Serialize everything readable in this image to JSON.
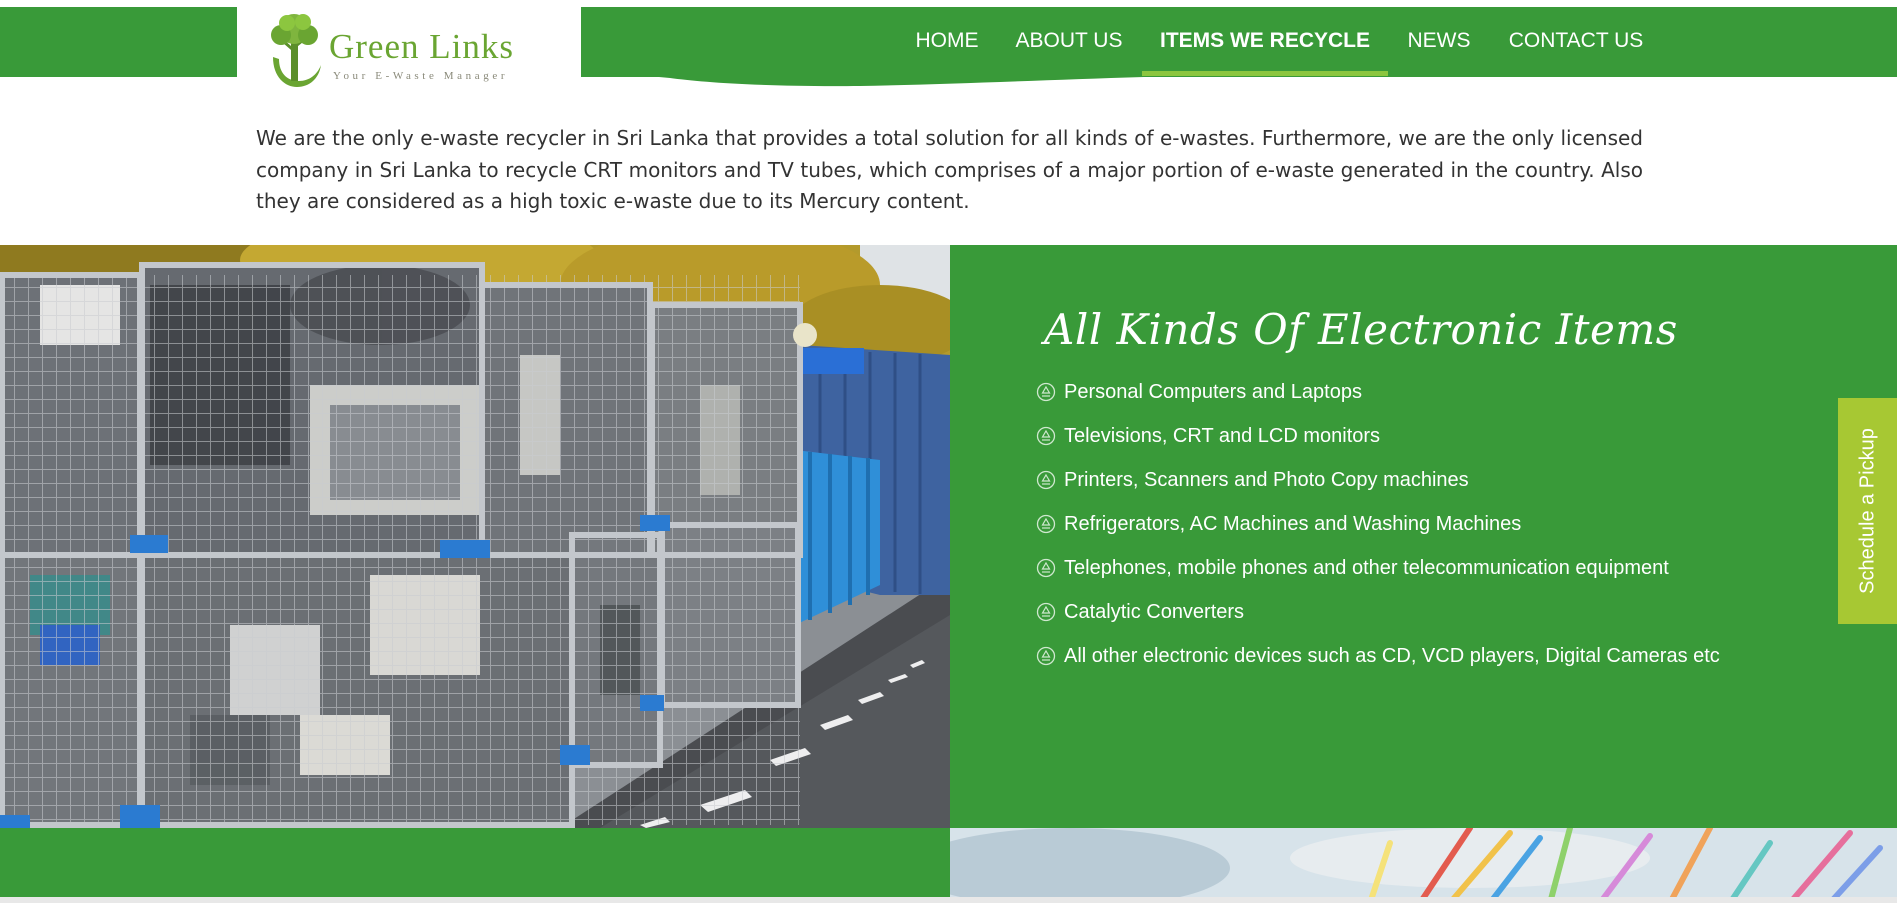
{
  "brand": {
    "name": "Green Links",
    "tagline": "Your E-Waste Manager"
  },
  "nav": {
    "items": [
      {
        "label": "HOME",
        "active": false
      },
      {
        "label": "ABOUT US",
        "active": false
      },
      {
        "label": "ITEMS WE RECYCLE",
        "active": true
      },
      {
        "label": "NEWS",
        "active": false
      },
      {
        "label": "CONTACT US",
        "active": false
      }
    ]
  },
  "intro": {
    "text": "We are the only e-waste recycler in Sri Lanka that provides a total solution for all kinds of e-wastes. Furthermore, we are the only licensed company in Sri Lanka to recycle CRT monitors and TV tubes, which comprises of a major portion of e-waste generated in the country. Also they are considered as a high toxic e-waste due to its Mercury content."
  },
  "items_section": {
    "title": "All Kinds Of Electronic Items",
    "items": [
      "Personal Computers and Laptops",
      "Televisions, CRT and LCD monitors",
      "Printers, Scanners and Photo Copy machines",
      "Refrigerators, AC Machines and Washing Machines",
      "Telephones, mobile phones and other telecommunication equipment",
      "Catalytic Converters",
      "All other electronic devices such as CD, VCD players, Digital Cameras etc"
    ]
  },
  "schedule_tab": {
    "label": "Schedule a Pickup"
  },
  "colors": {
    "brand_green": "#399a39",
    "logo_green": "#6aa532",
    "nav_underline": "#8cc63f",
    "schedule_tab": "#a7c833",
    "body_text": "#333333"
  },
  "icons": {
    "list_bullet": "recycle-icon",
    "logo": "tree-icon"
  }
}
